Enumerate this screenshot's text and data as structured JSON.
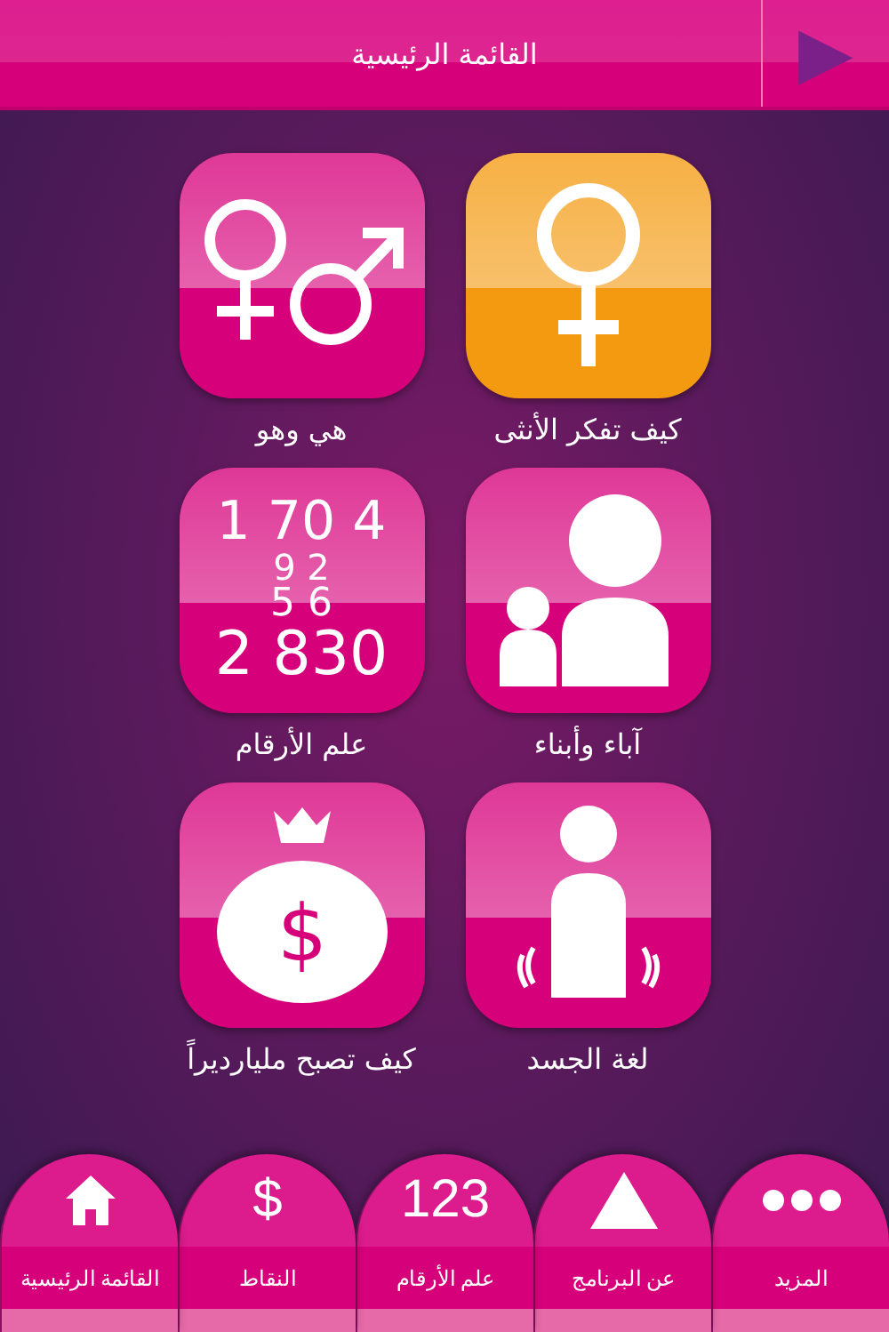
{
  "header": {
    "title": "القائمة الرئيسية",
    "back_arrow": "▶"
  },
  "tile_rows": [
    {
      "tiles": [
        {
          "kind": "female",
          "label": "كيف تفكر الأنثى",
          "color": "#f49a10"
        },
        {
          "kind": "couple",
          "label": "هي وهو",
          "color": "#d6007a"
        }
      ]
    },
    {
      "tiles": [
        {
          "kind": "parents",
          "label": "آباء وأبناء",
          "color": "#d6007a"
        },
        {
          "kind": "numbers",
          "label": "علم الأرقام",
          "color": "#d6007a",
          "digit_rows": [
            "1 70 4",
            "9 2",
            "5 6",
            "2 830"
          ]
        }
      ]
    },
    {
      "tiles": [
        {
          "kind": "body",
          "label": "لغة الجسد",
          "color": "#d6007a"
        },
        {
          "kind": "money",
          "label": "كيف تصبح مليارديراً",
          "color": "#d6007a",
          "symbol": "$"
        }
      ]
    }
  ],
  "tabs": [
    {
      "kind": "dots",
      "label": "المزيد"
    },
    {
      "kind": "triangle",
      "label": "عن البرنامج"
    },
    {
      "kind": "text",
      "glyph": "123",
      "label": "علم الأرقام"
    },
    {
      "kind": "text",
      "glyph": "$",
      "label": "النقاط"
    },
    {
      "kind": "home",
      "label": "القائمة الرئيسية"
    }
  ]
}
